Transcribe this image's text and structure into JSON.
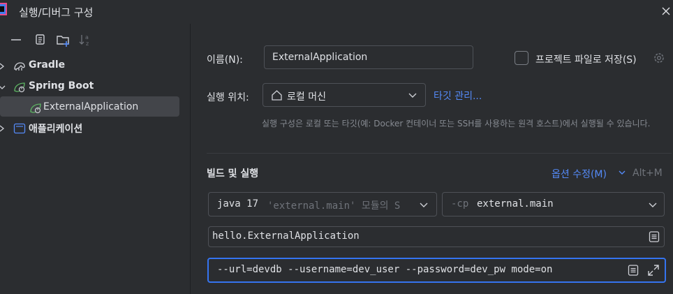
{
  "window": {
    "title": "실행/디버그 구성"
  },
  "tree": {
    "items": [
      {
        "label": "Gradle",
        "expanded": false
      },
      {
        "label": "Spring Boot",
        "expanded": true
      },
      {
        "label": "ExternalApplication",
        "selected": true
      },
      {
        "label": "애플리케이션",
        "expanded": false
      }
    ]
  },
  "form": {
    "name_label": "이름(N):",
    "name_value": "ExternalApplication",
    "store_label": "프로젝트 파일로 저장(S)",
    "run_on_label": "실행 위치:",
    "run_on_value": "로컬 머신",
    "manage_targets": "타깃 관리...",
    "hint": "실행 구성은 로컬 또는 타깃(예: Docker 컨테이너 또는 SSH를 사용하는 원격 호스트)에서 실행될 수 있습니다.",
    "section_title": "빌드 및 실행",
    "modify_options": "옵션 수정(M)",
    "modify_shortcut": "Alt+M",
    "jre_prefix": "java 17",
    "jre_suffix": "'external.main' 모듈의 S",
    "cp_prefix": "-cp",
    "cp_value": "external.main",
    "main_class": "hello.ExternalApplication",
    "program_args": "--url=devdb --username=dev_user --password=dev_pw mode=on"
  },
  "colors": {
    "accent": "#3574f0",
    "link": "#548af7",
    "background": "#2b2d30"
  }
}
